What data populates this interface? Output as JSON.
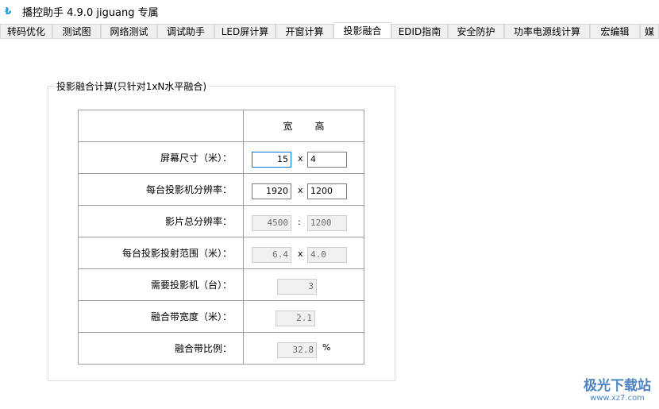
{
  "window": {
    "title": "播控助手 4.9.0  jiguang 专属",
    "logo": "播"
  },
  "tabs": [
    "转码优化",
    "测试图",
    "网络测试",
    "调试助手",
    "LED屏计算",
    "开窗计算",
    "投影融合",
    "EDID指南",
    "安全防护",
    "功率电源线计算",
    "宏编辑",
    "媒"
  ],
  "active_tab": "投影融合",
  "group": {
    "title": "投影融合计算(只针对1xN水平融合)",
    "header": {
      "width": "宽",
      "height": "高"
    },
    "rows": [
      {
        "label": "屏幕尺寸（米）：",
        "a": "15",
        "sep": "x",
        "b": "4"
      },
      {
        "label": "每台投影机分辨率：",
        "a": "1920",
        "sep": "x",
        "b": "1200"
      },
      {
        "label": "影片总分辨率：",
        "a": "4500",
        "sep": ":",
        "b": "1200"
      },
      {
        "label": "每台投影投射范围（米）：",
        "a": "6.4",
        "sep": "x",
        "b": "4.0"
      },
      {
        "label": "需要投影机（台）：",
        "a": "3"
      },
      {
        "label": "融合带宽度（米）：",
        "a": "2.1"
      },
      {
        "label": "融合带比例：",
        "a": "32.8",
        "unit": "%"
      }
    ]
  },
  "watermark": {
    "name": "极光下载站",
    "url": "www.xz7.com"
  }
}
